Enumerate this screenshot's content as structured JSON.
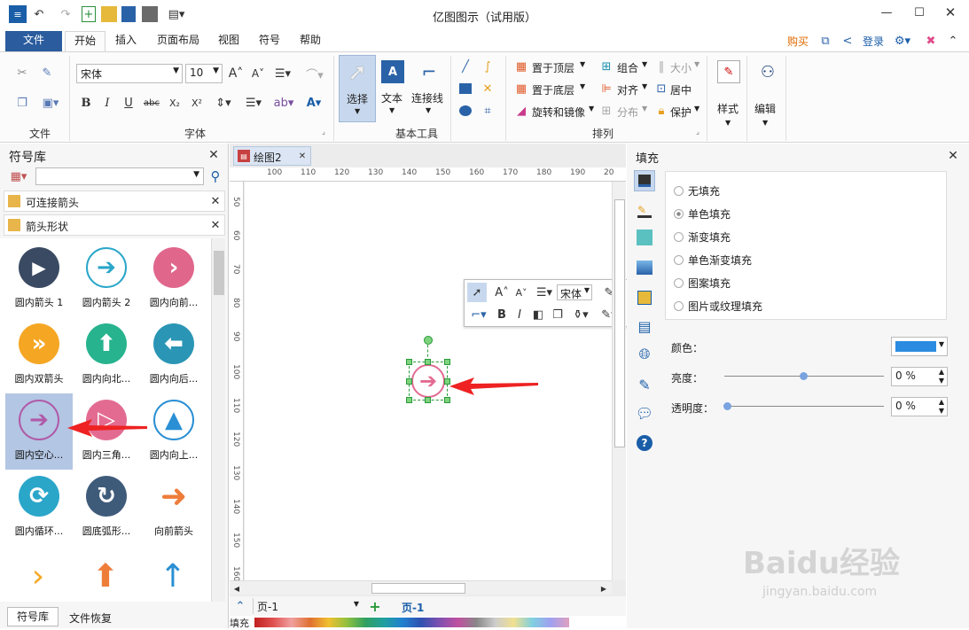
{
  "window": {
    "title": "亿图图示（试用版）"
  },
  "tabs": {
    "file": "文件",
    "home": "开始",
    "insert": "插入",
    "page_layout": "页面布局",
    "view": "视图",
    "symbol": "符号",
    "help": "帮助"
  },
  "top_right": {
    "buy": "购买",
    "login": "登录"
  },
  "ribbon": {
    "groups": {
      "file": "文件",
      "font": "字体",
      "basic_tools": "基本工具",
      "arrange": "排列"
    },
    "font_name": "宋体",
    "font_size": "10",
    "tools": {
      "select": "选择",
      "text": "文本",
      "connector": "连接线"
    },
    "arrange": {
      "bring_front": "置于顶层",
      "send_back": "置于底层",
      "rotate_mirror": "旋转和镜像",
      "group": "组合",
      "align": "对齐",
      "distribute": "分布",
      "size": "大小",
      "center": "居中",
      "protect": "保护"
    },
    "style": "样式",
    "edit": "编辑"
  },
  "library": {
    "title": "符号库",
    "categories": [
      {
        "label": "可连接箭头"
      },
      {
        "label": "箭头形状"
      }
    ],
    "symbols": [
      {
        "label": "圆内箭头 1",
        "color": "#3a4a63"
      },
      {
        "label": "圆内箭头 2",
        "color": "#2aa6c9"
      },
      {
        "label": "圆内向前...",
        "color": "#e0668c"
      },
      {
        "label": "圆内双箭头",
        "color": "#f5a623"
      },
      {
        "label": "圆内向北...",
        "color": "#26b38e"
      },
      {
        "label": "圆内向后...",
        "color": "#2a95b5"
      },
      {
        "label": "圆内空心...",
        "color": "#b05aa8"
      },
      {
        "label": "圆内三角...",
        "color": "#e36b92"
      },
      {
        "label": "圆内向上...",
        "color": "#2a8fd4"
      },
      {
        "label": "圆内循环...",
        "color": "#2aa6c9"
      },
      {
        "label": "圆底弧形...",
        "color": "#3f5b7a"
      },
      {
        "label": "向前箭头",
        "color": "#ee7d3a"
      }
    ],
    "bottom_tabs": {
      "library": "符号库",
      "recovery": "文件恢复"
    }
  },
  "document": {
    "tab": "绘图2",
    "page": "页-1",
    "page_tab": "页-1",
    "fill_label": "填充"
  },
  "ruler": {
    "h": [
      "100",
      "110",
      "120",
      "130",
      "140",
      "150",
      "160",
      "170",
      "180",
      "190",
      "20"
    ],
    "v": [
      "50",
      "60",
      "70",
      "80",
      "90",
      "100",
      "110",
      "120",
      "130",
      "140",
      "150",
      "160"
    ]
  },
  "mini_toolbar": {
    "font": "宋体"
  },
  "fill_panel": {
    "title": "填充",
    "options": [
      "无填充",
      "单色填充",
      "渐变填充",
      "单色渐变填充",
      "图案填充",
      "图片或纹理填充"
    ],
    "selected": "单色填充",
    "color_label": "颜色：",
    "color_value": "#2b8be0",
    "brightness_label": "亮度：",
    "brightness_value": "0 %",
    "transparency_label": "透明度：",
    "transparency_value": "0 %"
  },
  "watermark": {
    "brand": "Baidu经验",
    "url": "jingyan.baidu.com"
  }
}
